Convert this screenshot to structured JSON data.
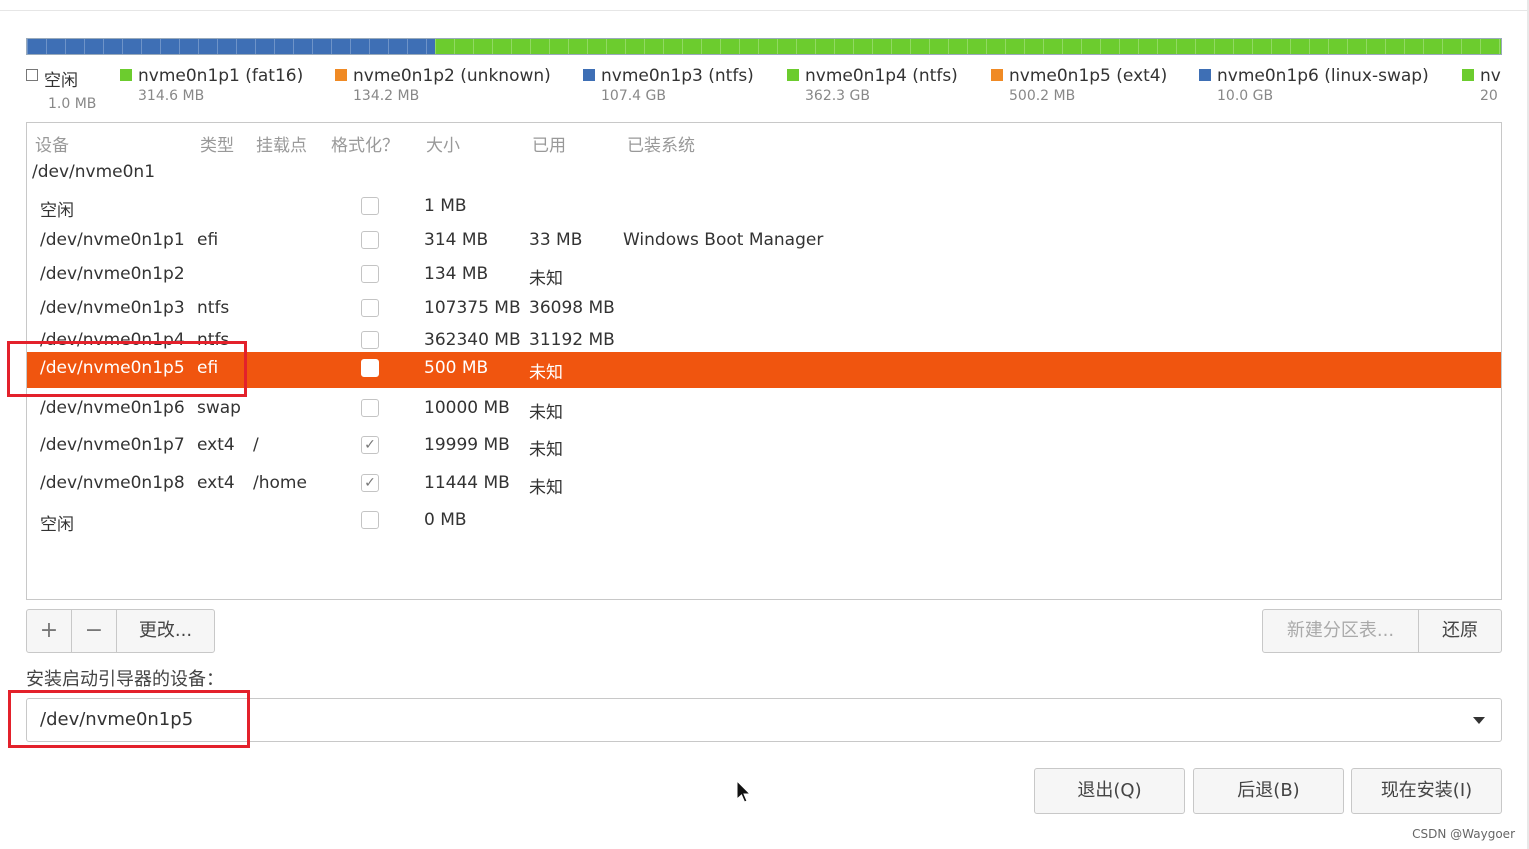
{
  "legend": [
    {
      "name": "空闲",
      "size": "1.0 MB",
      "swatch": "#ffffff"
    },
    {
      "name": "nvme0n1p1 (fat16)",
      "size": "314.6 MB",
      "swatch": "#6ccc2e"
    },
    {
      "name": "nvme0n1p2 (unknown)",
      "size": "134.2 MB",
      "swatch": "#f08a24"
    },
    {
      "name": "nvme0n1p3 (ntfs)",
      "size": "107.4 GB",
      "swatch": "#3e6fb5"
    },
    {
      "name": "nvme0n1p4 (ntfs)",
      "size": "362.3 GB",
      "swatch": "#6ccc2e"
    },
    {
      "name": "nvme0n1p5 (ext4)",
      "size": "500.2 MB",
      "swatch": "#f08a24"
    },
    {
      "name": "nvme0n1p6 (linux-swap)",
      "size": "10.0 GB",
      "swatch": "#3e6fb5"
    },
    {
      "name": "nv",
      "size": "20",
      "swatch": "#6ccc2e"
    }
  ],
  "table": {
    "headers": {
      "device": "设备",
      "type": "类型",
      "mount": "挂载点",
      "format": "格式化？",
      "size": "大小",
      "used": "已用",
      "system": "已装系统"
    },
    "group": "/dev/nvme0n1",
    "rows": [
      {
        "device": "空闲",
        "type": "",
        "mount": "",
        "format": false,
        "size": "1 MB",
        "used": "",
        "system": ""
      },
      {
        "device": "/dev/nvme0n1p1",
        "type": "efi",
        "mount": "",
        "format": false,
        "size": "314 MB",
        "used": "33 MB",
        "system": "Windows Boot Manager"
      },
      {
        "device": "/dev/nvme0n1p2",
        "type": "",
        "mount": "",
        "format": false,
        "size": "134 MB",
        "used": "未知",
        "system": ""
      },
      {
        "device": "/dev/nvme0n1p3",
        "type": "ntfs",
        "mount": "",
        "format": false,
        "size": "107375 MB",
        "used": "36098 MB",
        "system": ""
      },
      {
        "device": "/dev/nvme0n1p4",
        "type": "ntfs",
        "mount": "",
        "format": false,
        "size": "362340 MB",
        "used": "31192 MB",
        "system": ""
      },
      {
        "device": "/dev/nvme0n1p5",
        "type": "efi",
        "mount": "",
        "format": false,
        "size": "500 MB",
        "used": "未知",
        "system": "",
        "selected": true
      },
      {
        "device": "/dev/nvme0n1p6",
        "type": "swap",
        "mount": "",
        "format": false,
        "size": "10000 MB",
        "used": "未知",
        "system": ""
      },
      {
        "device": "/dev/nvme0n1p7",
        "type": "ext4",
        "mount": "/",
        "format": true,
        "size": "19999 MB",
        "used": "未知",
        "system": ""
      },
      {
        "device": "/dev/nvme0n1p8",
        "type": "ext4",
        "mount": "/home",
        "format": true,
        "size": "11444 MB",
        "used": "未知",
        "system": ""
      },
      {
        "device": "空闲",
        "type": "",
        "mount": "",
        "format": false,
        "size": "0 MB",
        "used": "",
        "system": ""
      }
    ]
  },
  "toolbar": {
    "add_label": "+",
    "remove_label": "−",
    "change_label": "更改...",
    "new_table_label": "新建分区表...",
    "revert_label": "还原"
  },
  "bootloader": {
    "label": "安装启动引导器的设备：",
    "value": "/dev/nvme0n1p5"
  },
  "actions": {
    "quit_label": "退出(Q)",
    "back_label": "后退(B)",
    "install_label": "现在安装(I)"
  },
  "watermark": "CSDN @Waygoer",
  "colors": {
    "selection": "#f0550f",
    "highlight_box": "#e3212b",
    "bar_blue": "#3e6fb5",
    "bar_green": "#6ccc2e"
  }
}
